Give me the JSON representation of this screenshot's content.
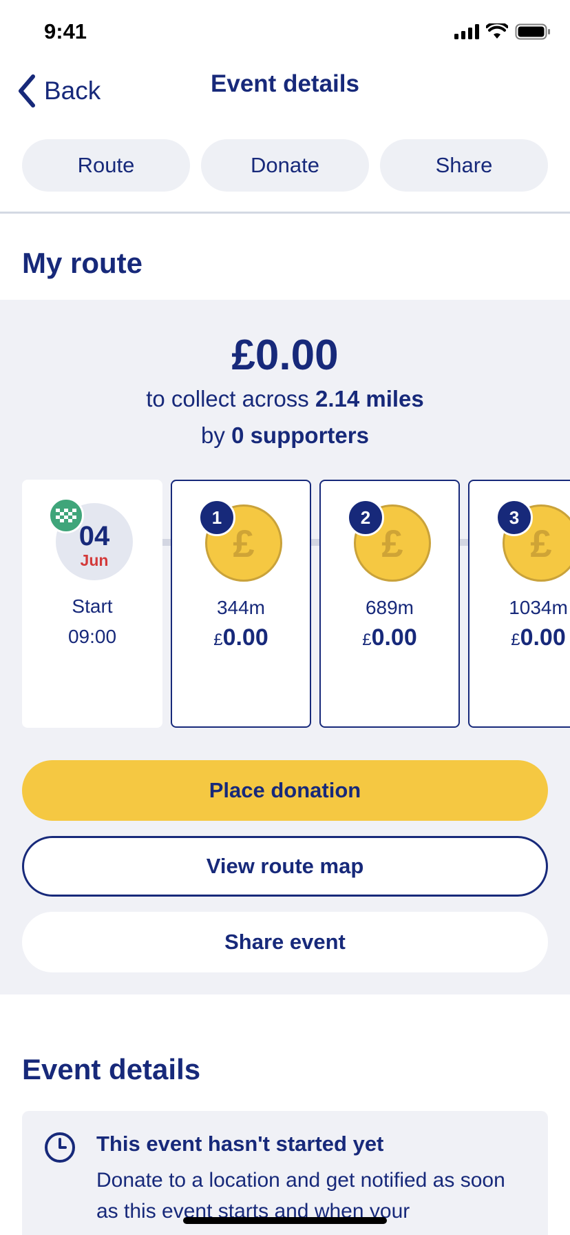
{
  "status_bar": {
    "time": "9:41"
  },
  "nav": {
    "back_label": "Back",
    "title": "Event details"
  },
  "tabs": [
    {
      "label": "Route"
    },
    {
      "label": "Donate"
    },
    {
      "label": "Share"
    }
  ],
  "route": {
    "section_title": "My route",
    "amount": "£0.00",
    "collect_prefix": "to collect across ",
    "distance": "2.14 miles",
    "by_prefix": "by ",
    "supporters": "0 supporters",
    "start": {
      "day": "04",
      "month": "Jun",
      "label": "Start",
      "time": "09:00"
    },
    "stops": [
      {
        "number": "1",
        "distance": "344m",
        "currency": "£",
        "amount": "0.00"
      },
      {
        "number": "2",
        "distance": "689m",
        "currency": "£",
        "amount": "0.00"
      },
      {
        "number": "3",
        "distance": "1034m",
        "currency": "£",
        "amount": "0.00"
      }
    ],
    "coin_symbol": "£"
  },
  "actions": {
    "place_donation": "Place donation",
    "view_route_map": "View route map",
    "share_event": "Share event"
  },
  "event_details": {
    "section_title": "Event details",
    "status_title": "This event hasn't started yet",
    "status_body": "Donate to a location and get notified as soon as this event starts and when your"
  },
  "colors": {
    "brand_navy": "#17297a",
    "accent_yellow": "#f5c842",
    "panel_grey": "#f0f1f6",
    "start_flag_green": "#3fa57a",
    "month_red": "#d33a3a"
  }
}
